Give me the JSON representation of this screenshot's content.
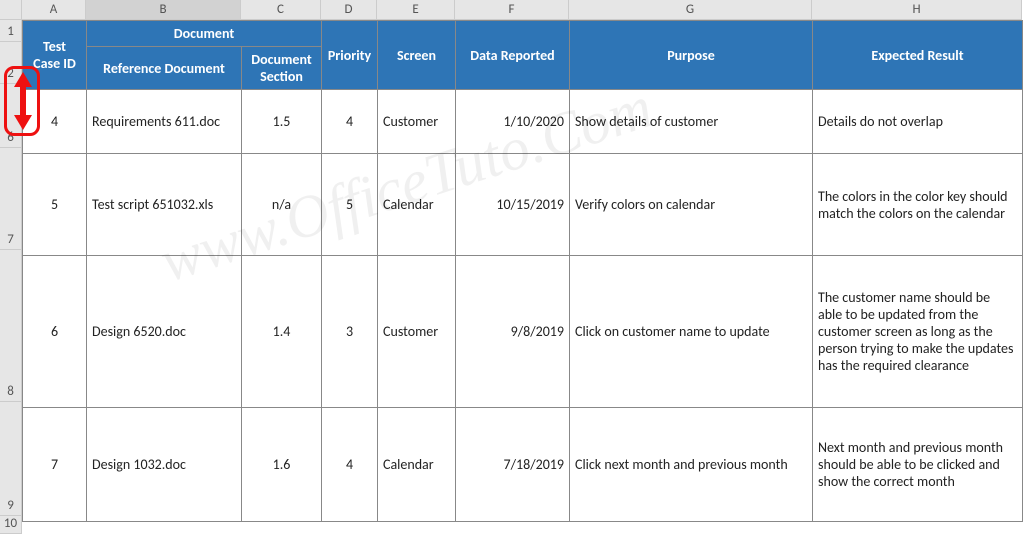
{
  "columns": {
    "A": "A",
    "B": "B",
    "C": "C",
    "D": "D",
    "E": "E",
    "F": "F",
    "G": "G",
    "H": "H"
  },
  "rows": {
    "r1": "1",
    "r2": "2",
    "r6": "6",
    "r7": "7",
    "r8": "8",
    "r9": "9",
    "r10": "10"
  },
  "headers": {
    "test_case_id": "Test Case ID",
    "document": "Document",
    "reference_document": "Reference Document",
    "document_section": "Document Section",
    "priority": "Priority",
    "screen": "Screen",
    "data_reported": "Data Reported",
    "purpose": "Purpose",
    "expected_result": "Expected Result"
  },
  "data": [
    {
      "id": "4",
      "ref": "Requirements 611.doc",
      "sec": "1.5",
      "pri": "4",
      "scr": "Customer",
      "date": "1/10/2020",
      "purpose": "Show details of customer",
      "expected": "Details do not overlap"
    },
    {
      "id": "5",
      "ref": "Test script 651032.xls",
      "sec": "n/a",
      "pri": "5",
      "scr": "Calendar",
      "date": "10/15/2019",
      "purpose": "Verify colors on calendar",
      "expected": "The colors in the color key should match the colors on the calendar"
    },
    {
      "id": "6",
      "ref": "Design 6520.doc",
      "sec": "1.4",
      "pri": "3",
      "scr": "Customer",
      "date": "9/8/2019",
      "purpose": "Click on customer name to update",
      "expected": "The customer name should be able to be updated from the customer screen as long as the person trying to make the updates has the required clearance"
    },
    {
      "id": "7",
      "ref": "Design 1032.doc",
      "sec": "1.6",
      "pri": "4",
      "scr": "Calendar",
      "date": "7/18/2019",
      "purpose": "Click next month and previous month",
      "expected": "Next month and previous month should be able to be clicked and show the correct month"
    }
  ],
  "watermark": "www.OfficeTuto.Com"
}
